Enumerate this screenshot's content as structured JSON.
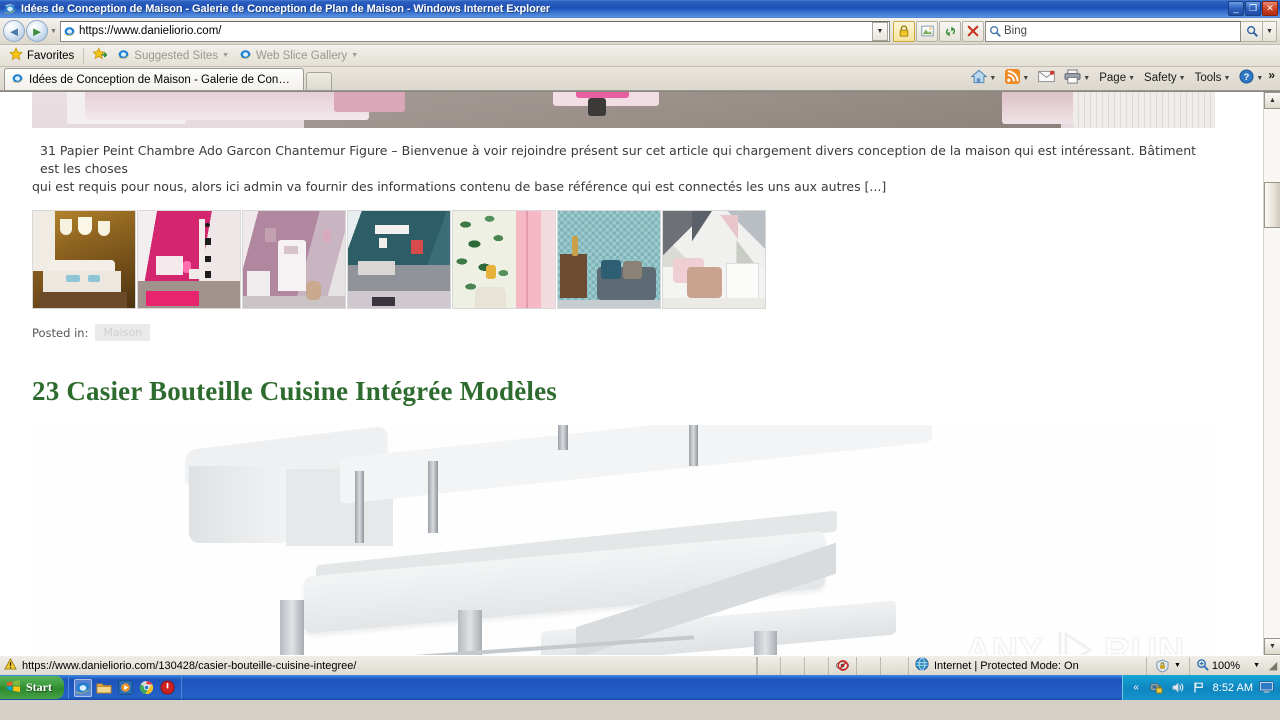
{
  "window": {
    "title": "Idées de Conception de Maison - Galerie de Conception de Plan de Maison - Windows Internet Explorer",
    "minimize_label": "_",
    "maximize_label": "❐",
    "close_label": "✕"
  },
  "nav": {
    "back_label": "◄",
    "forward_label": "►",
    "recent_caret": "▼",
    "address_value": "https://www.danieliorio.com/",
    "address_dropdown_caret": "▼",
    "icons": {
      "page_icon": "ie-page-icon",
      "lock_icon": "lock-icon",
      "compat_icon": "compatibility-view-icon",
      "refresh_icon": "refresh-icon",
      "stop_icon": "stop-icon"
    },
    "search_placeholder": "Bing",
    "search_go_label": "⌕",
    "search_dropdown_caret": "▼"
  },
  "favorites_bar": {
    "favorites_label": "Favorites",
    "add_to_favorites_icon": "add-favorites-icon",
    "items": [
      {
        "label": "Suggested Sites",
        "caret": "▼"
      },
      {
        "label": "Web Slice Gallery",
        "caret": "▼"
      }
    ]
  },
  "tabs": {
    "items": [
      {
        "label": "Idées de Conception de Maison - Galerie de Conceptio..."
      }
    ],
    "new_tab_label": ""
  },
  "command_bar": {
    "items": [
      {
        "name": "home",
        "label": "",
        "icon": "home-icon",
        "caret": "▼"
      },
      {
        "name": "feeds",
        "label": "",
        "icon": "rss-icon",
        "caret": "▼"
      },
      {
        "name": "mail",
        "label": "",
        "icon": "mail-icon",
        "caret": ""
      },
      {
        "name": "print",
        "label": "",
        "icon": "printer-icon",
        "caret": "▼"
      },
      {
        "name": "page",
        "label": "Page",
        "icon": "",
        "caret": "▼"
      },
      {
        "name": "safety",
        "label": "Safety",
        "icon": "",
        "caret": "▼"
      },
      {
        "name": "tools",
        "label": "Tools",
        "icon": "",
        "caret": "▼"
      },
      {
        "name": "help",
        "label": "",
        "icon": "help-icon",
        "caret": "▼"
      }
    ],
    "overflow_label": "»"
  },
  "page": {
    "excerpt_line1": "31 Papier Peint Chambre Ado Garcon Chantemur Figure – Bienvenue à voir rejoindre présent sur cet article qui chargement divers conception de la maison qui est intéressant. Bâtiment est les choses",
    "excerpt_line2": "qui est requis pour nous, alors ici admin va fournir des informations contenu de base référence qui est connectés les uns aux autres [...]",
    "posted_in_label": "Posted in:",
    "category_tag": "Maison",
    "post_title": "23 Casier Bouteille Cuisine Intégrée Modèles",
    "post_title_color": "#2e6b2e",
    "thumbnails": [
      {
        "alt": "chambre-papier-peint-dore-lit-blanc"
      },
      {
        "alt": "chambre-rose-fuchsia-etoiles"
      },
      {
        "alt": "chambre-mauve-armoire-blanche"
      },
      {
        "alt": "chambre-bleu-canard-lit-gris"
      },
      {
        "alt": "papier-peint-feuillage-porte-rose"
      },
      {
        "alt": "papier-peint-bleu-vert-commode-bois"
      },
      {
        "alt": "papier-peint-triangles-gris-fauteuil"
      }
    ],
    "watermark_left": "ANY",
    "watermark_right": "RUN"
  },
  "scrollbar": {
    "up_arrow": "▲",
    "down_arrow": "▼"
  },
  "status_bar": {
    "warning_icon": "warning-icon",
    "status_url": "https://www.danieliorio.com/130428/casier-bouteille-cuisine-integree/",
    "blocked_icon": "popup-blocked-icon",
    "globe_icon": "internet-zone-icon",
    "zone_text": "Internet | Protected Mode: On",
    "protected_icon": "protected-mode-icon",
    "protected_caret": "▼",
    "zoom_icon": "zoom-icon",
    "zoom_level": "100%",
    "zoom_caret": "▼"
  },
  "taskbar": {
    "start_label": "Start",
    "quick_launch": [
      {
        "name": "internet-explorer",
        "icon": "ie-icon",
        "active": true
      },
      {
        "name": "windows-explorer",
        "icon": "folder-icon",
        "active": false
      },
      {
        "name": "media-player",
        "icon": "media-player-icon",
        "active": false
      },
      {
        "name": "google-chrome",
        "icon": "chrome-icon",
        "active": false
      },
      {
        "name": "shutdown-tool",
        "icon": "power-icon",
        "active": false
      }
    ],
    "tray": {
      "expand_caret": "«",
      "icons": [
        {
          "name": "network-icon",
          "glyph": "🖧"
        },
        {
          "name": "volume-icon",
          "glyph": "🔊"
        },
        {
          "name": "flag-icon",
          "glyph": "⚑"
        }
      ],
      "clock": "8:52 AM",
      "show_desktop_icon": "show-desktop-icon"
    }
  },
  "colors": {
    "titlebar_blue": "#1e4fb4",
    "green_heading": "#2e6b2e",
    "taskbar_blue": "#2461c6",
    "start_green": "#3d9a3d"
  }
}
